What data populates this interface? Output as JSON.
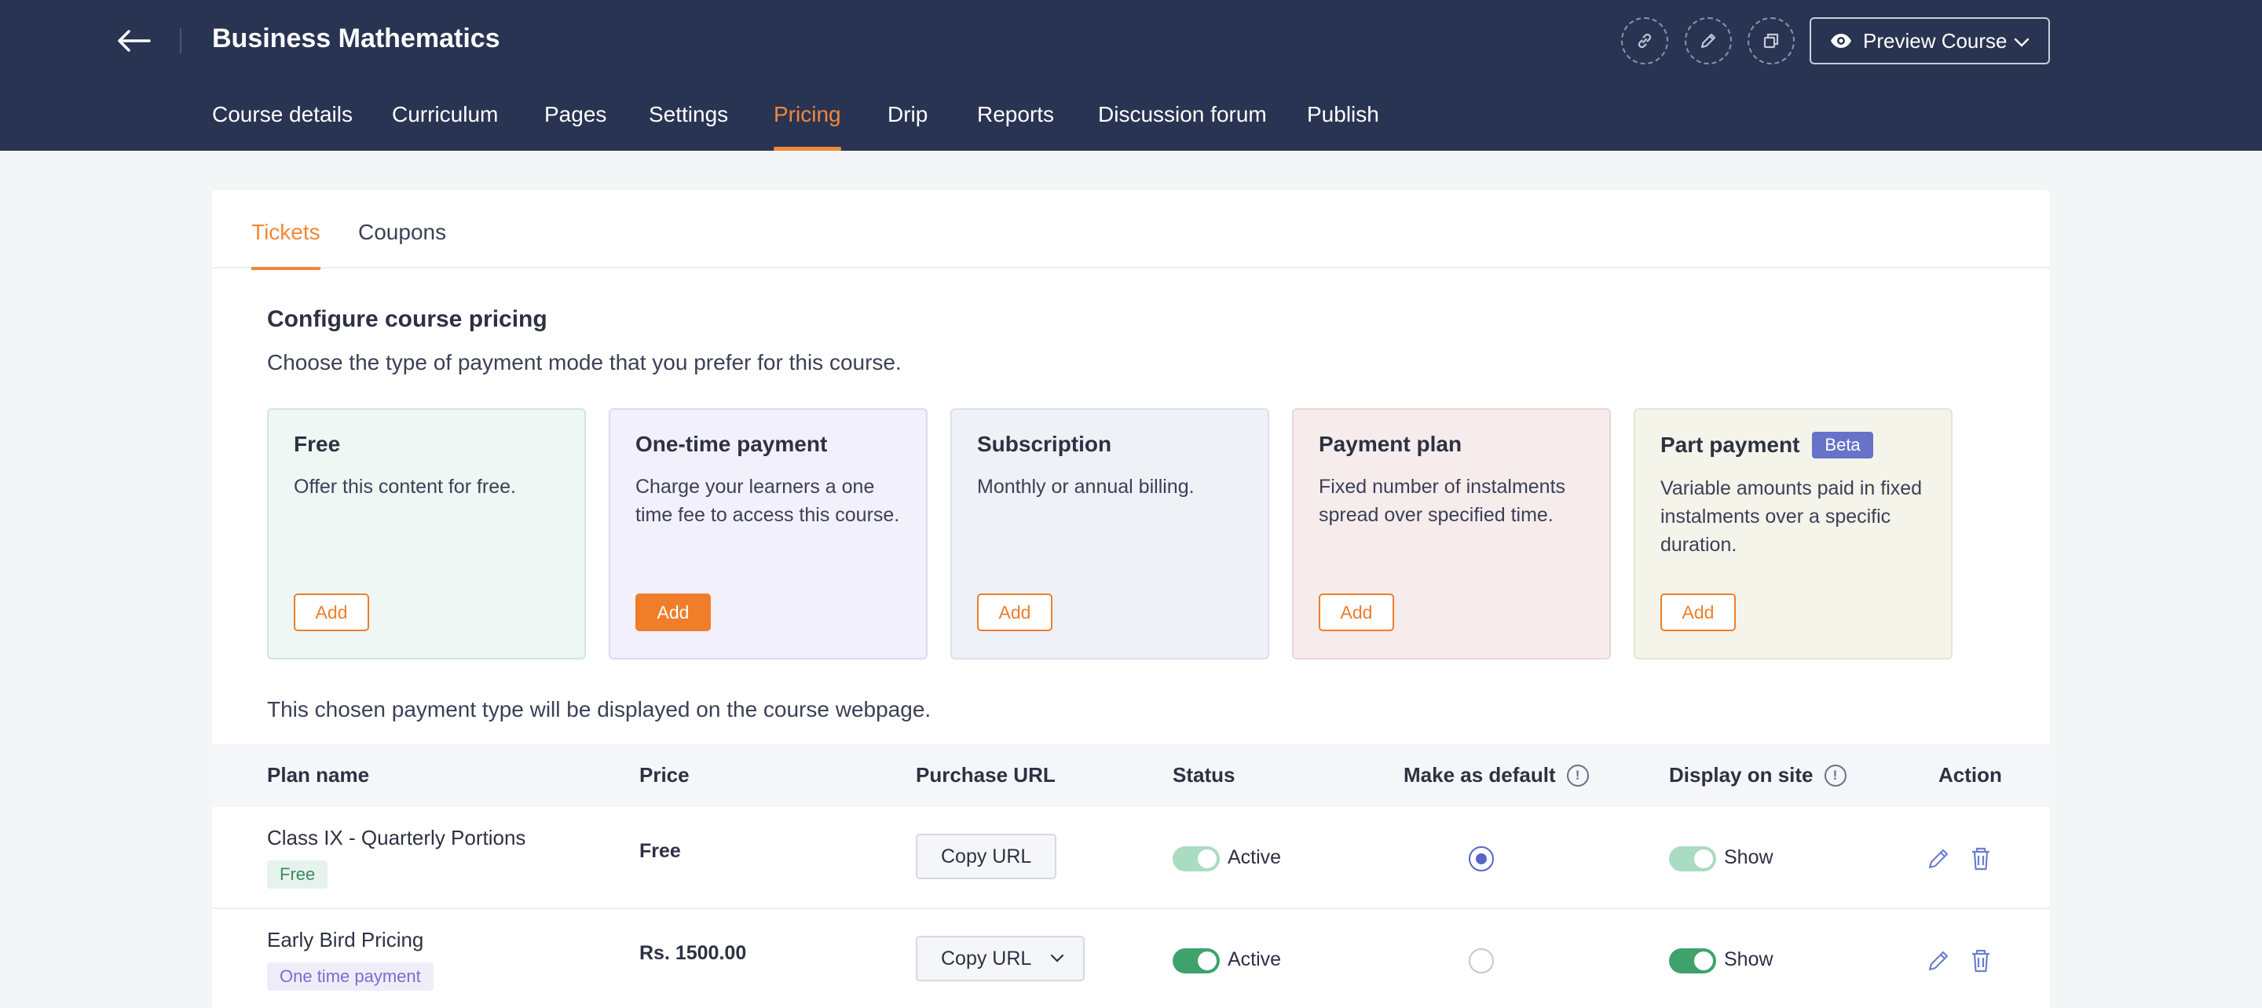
{
  "header": {
    "course_title": "Business Mathematics",
    "preview_label": "Preview Course",
    "nav": [
      {
        "label": "Course details"
      },
      {
        "label": "Curriculum"
      },
      {
        "label": "Pages"
      },
      {
        "label": "Settings"
      },
      {
        "label": "Pricing",
        "active": true
      },
      {
        "label": "Drip"
      },
      {
        "label": "Reports"
      },
      {
        "label": "Discussion forum"
      },
      {
        "label": "Publish"
      }
    ],
    "icons": [
      "link-icon",
      "pencil-icon",
      "copy-icon"
    ]
  },
  "subtabs": [
    {
      "label": "Tickets",
      "active": true
    },
    {
      "label": "Coupons"
    }
  ],
  "pricing": {
    "title": "Configure course pricing",
    "description": "Choose the type of payment mode that you prefer for this course.",
    "types": [
      {
        "title": "Free",
        "desc": "Offer this content for free.",
        "button": "Add",
        "bg": "#eef7f3",
        "border": "#cfe8dc",
        "filled": false
      },
      {
        "title": "One-time payment",
        "desc": "Charge your learners a one time fee to access this course.",
        "button": "Add",
        "bg": "#f1f0fb",
        "border": "#dcdaf3",
        "filled": true
      },
      {
        "title": "Subscription",
        "desc": "Monthly or annual billing.",
        "button": "Add",
        "bg": "#eef1f6",
        "border": "#dbe0ea",
        "filled": false
      },
      {
        "title": "Payment plan",
        "desc": "Fixed number of instalments spread over specified time.",
        "button": "Add",
        "bg": "#f6ecec",
        "border": "#ecd6d6",
        "filled": false
      },
      {
        "title": "Part payment",
        "badge": "Beta",
        "desc": "Variable amounts paid in fixed instalments over a specific duration.",
        "button": "Add",
        "bg": "#f4f4eb",
        "border": "#e5e6d3",
        "filled": false
      }
    ],
    "note": "This chosen payment type will be displayed on the course webpage."
  },
  "table": {
    "headers": {
      "plan_name": "Plan name",
      "price": "Price",
      "purchase_url": "Purchase URL",
      "status": "Status",
      "make_default": "Make as default",
      "display": "Display on site",
      "action": "Action"
    },
    "rows": [
      {
        "name": "Class IX - Quarterly Portions",
        "badge": "Free",
        "badge_bg": "#e6f3ec",
        "badge_color": "#3e8a5c",
        "price": "Free",
        "copy": "Copy URL",
        "status": "Active",
        "default": true,
        "display": "Show",
        "toggle_color": "#a9dcc1"
      },
      {
        "name": "Early Bird Pricing",
        "badge": "One time payment",
        "badge_bg": "#efedfa",
        "badge_color": "#7a6ccc",
        "price": "Rs. 1500.00",
        "copy": "Copy URL",
        "status": "Active",
        "default": false,
        "display": "Show",
        "toggle_color": "#3fa26b"
      }
    ]
  },
  "colors": {
    "accent": "#f0883a",
    "header_bg": "#293452"
  }
}
